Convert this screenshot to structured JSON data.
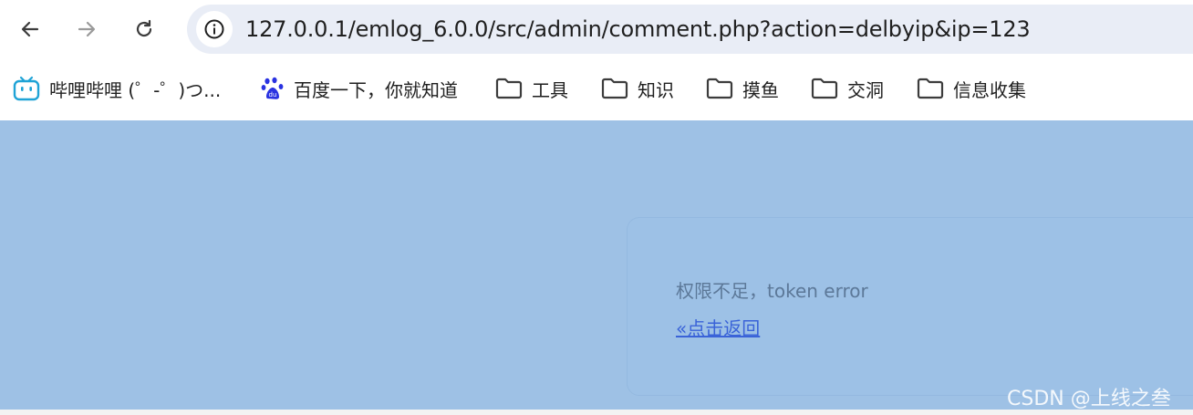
{
  "browser": {
    "url": "127.0.0.1/emlog_6.0.0/src/admin/comment.php?action=delbyip&ip=123",
    "icons": {
      "back": "arrow-left-icon",
      "forward": "arrow-right-icon",
      "reload": "reload-icon",
      "site_info": "info-icon"
    }
  },
  "bookmarks": [
    {
      "label": "哔哩哔哩 (゜-゜)つ...",
      "icon": "bilibili-icon"
    },
    {
      "label": "百度一下，你就知道",
      "icon": "baidu-paw-icon"
    },
    {
      "label": "工具",
      "icon": "folder-icon"
    },
    {
      "label": "知识",
      "icon": "folder-icon"
    },
    {
      "label": "摸鱼",
      "icon": "folder-icon"
    },
    {
      "label": "交洞",
      "icon": "folder-icon"
    },
    {
      "label": "信息收集",
      "icon": "folder-icon"
    }
  ],
  "page": {
    "message": "权限不足，token error",
    "back_link": "«点击返回",
    "watermark": "CSDN @上线之叁"
  },
  "colors": {
    "page_background": "#9ec1e5",
    "message_text": "#5c7898",
    "link": "#3a63d8",
    "omnibox": "#e9edf6"
  }
}
